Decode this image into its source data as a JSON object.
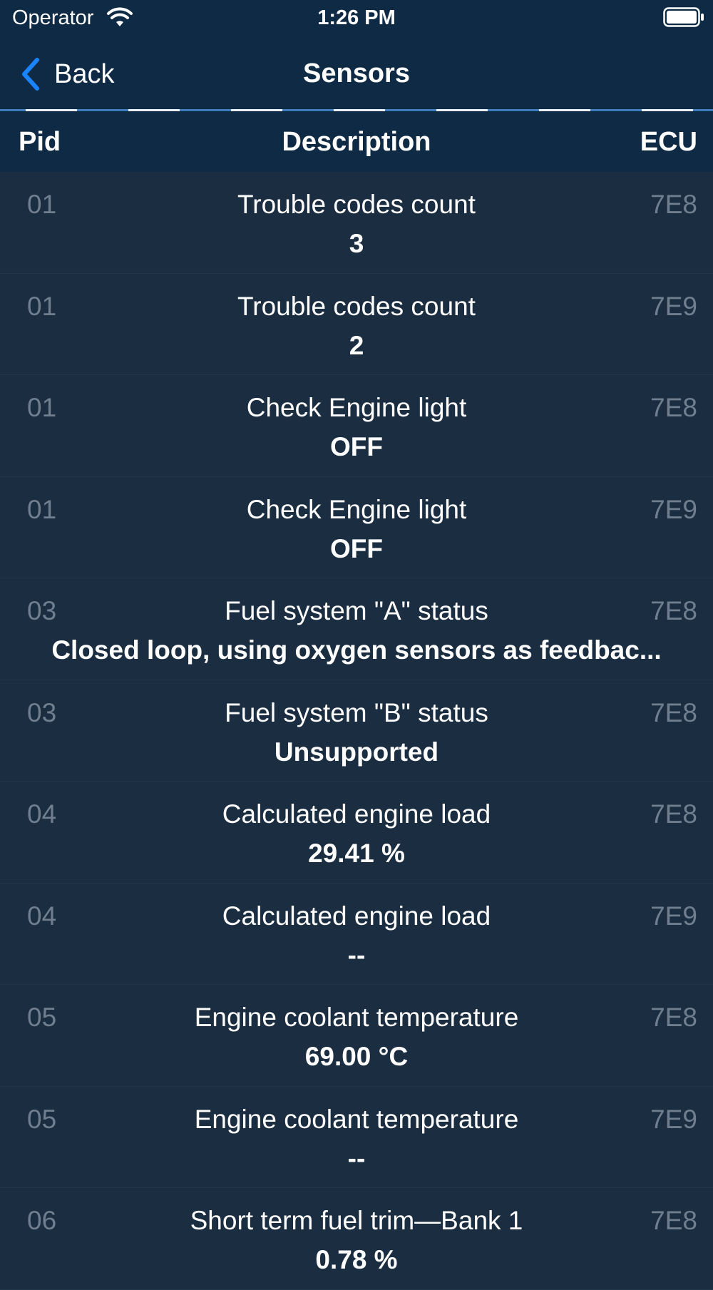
{
  "status_bar": {
    "carrier": "Operator",
    "time": "1:26 PM",
    "wifi_icon": "wifi-icon",
    "battery_icon": "battery-icon"
  },
  "nav": {
    "back_label": "Back",
    "title": "Sensors",
    "back_icon": "chevron-left-icon",
    "accent_color": "#1a84ff"
  },
  "columns": {
    "pid": "Pid",
    "description": "Description",
    "ecu": "ECU"
  },
  "rows": [
    {
      "pid": "01",
      "description": "Trouble codes count",
      "value": "3",
      "ecu": "7E8"
    },
    {
      "pid": "01",
      "description": "Trouble codes count",
      "value": "2",
      "ecu": "7E9"
    },
    {
      "pid": "01",
      "description": "Check Engine light",
      "value": "OFF",
      "ecu": "7E8"
    },
    {
      "pid": "01",
      "description": "Check Engine light",
      "value": "OFF",
      "ecu": "7E9"
    },
    {
      "pid": "03",
      "description": "Fuel system \"A\" status",
      "value": "Closed loop, using oxygen sensors as feedbac...",
      "ecu": "7E8"
    },
    {
      "pid": "03",
      "description": "Fuel system \"B\" status",
      "value": "Unsupported",
      "ecu": "7E8"
    },
    {
      "pid": "04",
      "description": "Calculated engine load",
      "value": "29.41 %",
      "ecu": "7E8"
    },
    {
      "pid": "04",
      "description": "Calculated engine load",
      "value": "--",
      "ecu": "7E9"
    },
    {
      "pid": "05",
      "description": "Engine coolant temperature",
      "value": "69.00 °C",
      "ecu": "7E8"
    },
    {
      "pid": "05",
      "description": "Engine coolant temperature",
      "value": "--",
      "ecu": "7E9"
    },
    {
      "pid": "06",
      "description": "Short term fuel trim—Bank 1",
      "value": "0.78 %",
      "ecu": "7E8"
    }
  ]
}
